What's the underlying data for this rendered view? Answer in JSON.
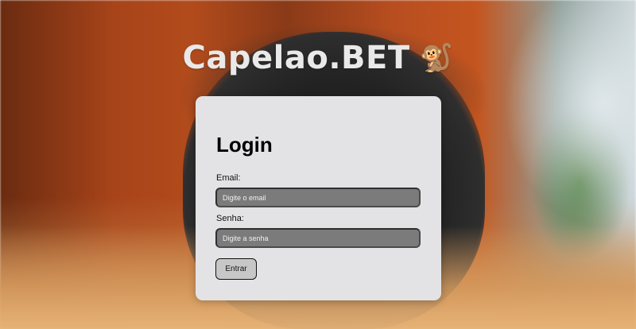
{
  "brand": {
    "title": "Capelao.BET",
    "emoji": "🐒"
  },
  "login": {
    "title": "Login",
    "email_label": "Email:",
    "email_placeholder": "Digite o email",
    "password_label": "Senha:",
    "password_placeholder": "Digite a senha",
    "submit_label": "Entrar"
  }
}
